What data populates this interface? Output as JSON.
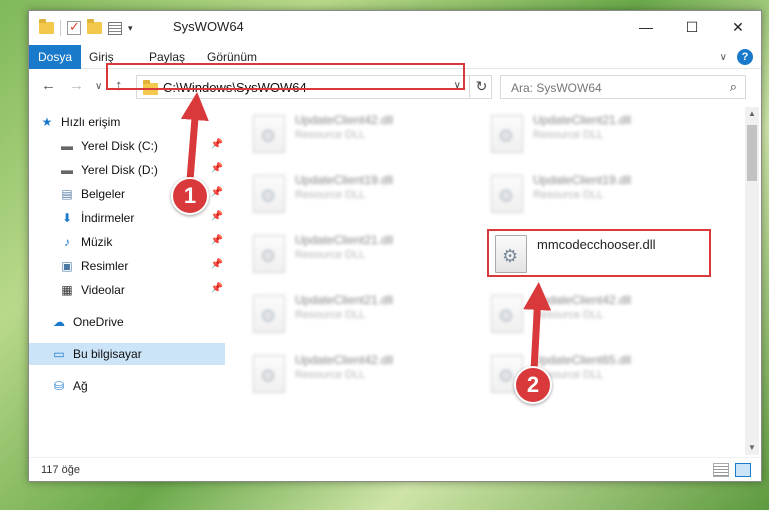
{
  "window": {
    "title": "SysWOW64",
    "minimize": "—",
    "maximize": "☐",
    "close": "✕"
  },
  "ribbon": {
    "tabs": [
      "Dosya",
      "Giriş",
      "Paylaş",
      "Görünüm"
    ],
    "expand": "∨",
    "help": "?"
  },
  "nav": {
    "back": "←",
    "forward": "→",
    "recent": "∨",
    "up": "↑",
    "address": "C:\\Windows\\SysWOW64",
    "address_dropdown": "∨",
    "refresh": "↻",
    "search_placeholder": "Ara: SysWOW64",
    "search_icon": "⌕"
  },
  "sidebar": {
    "items": [
      {
        "label": "Hızlı erişim",
        "icon": "star-icon",
        "glyph": "★",
        "pinned": false
      },
      {
        "label": "Yerel Disk (C:)",
        "icon": "drive-icon",
        "glyph": "▬",
        "pinned": true
      },
      {
        "label": "Yerel Disk (D:)",
        "icon": "drive-icon",
        "glyph": "▬",
        "pinned": true
      },
      {
        "label": "Belgeler",
        "icon": "documents-icon",
        "glyph": "▤",
        "pinned": true
      },
      {
        "label": "İndirmeler",
        "icon": "download-icon",
        "glyph": "⬇",
        "pinned": true
      },
      {
        "label": "Müzik",
        "icon": "music-icon",
        "glyph": "♪",
        "pinned": true
      },
      {
        "label": "Resimler",
        "icon": "pictures-icon",
        "glyph": "▣",
        "pinned": true
      },
      {
        "label": "Videolar",
        "icon": "videos-icon",
        "glyph": "▦",
        "pinned": true
      },
      {
        "label": "OneDrive",
        "icon": "cloud-icon",
        "glyph": "☁",
        "pinned": false
      },
      {
        "label": "Bu bilgisayar",
        "icon": "computer-icon",
        "glyph": "▭",
        "pinned": false
      },
      {
        "label": "Ağ",
        "icon": "network-icon",
        "glyph": "⛁",
        "pinned": false
      }
    ],
    "pin_glyph": "📌"
  },
  "files": [
    {
      "name": "UpdateClient42.dll",
      "desc": "Resource DLL",
      "blurred": true
    },
    {
      "name": "UpdateClient21.dll",
      "desc": "Resource DLL",
      "blurred": true
    },
    {
      "name": "UpdateClient19.dll",
      "desc": "Resource DLL",
      "blurred": true
    },
    {
      "name": "UpdateClient19.dll",
      "desc": "Resource DLL",
      "blurred": true
    },
    {
      "name": "UpdateClient21.dll",
      "desc": "Resource DLL",
      "blurred": true
    },
    {
      "name": "mmcodecchooser.dll",
      "desc": "",
      "blurred": false
    },
    {
      "name": "UpdateClient21.dll",
      "desc": "Resource DLL",
      "blurred": true
    },
    {
      "name": "UpdateClient42.dll",
      "desc": "Resource DLL",
      "blurred": true
    },
    {
      "name": "UpdateClient42.dll",
      "desc": "Resource DLL",
      "blurred": true
    },
    {
      "name": "UpdateClient65.dll",
      "desc": "Resource DLL",
      "blurred": true
    }
  ],
  "scrollbar": {
    "up": "▲",
    "down": "▼"
  },
  "status": {
    "count": "117 öğe"
  },
  "annotations": {
    "badge1": "1",
    "badge2": "2",
    "color": "#d9393a"
  },
  "colors": {
    "accent": "#1979ca",
    "highlight": "#d9393a",
    "selected": "#cce4f7"
  }
}
